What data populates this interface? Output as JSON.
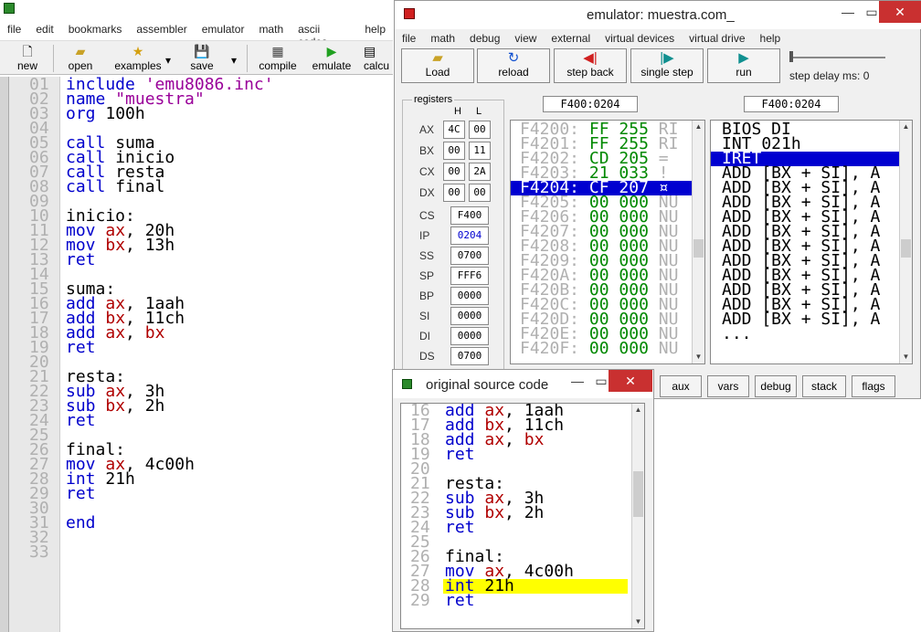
{
  "editor": {
    "menu": [
      "file",
      "edit",
      "bookmarks",
      "assembler",
      "emulator",
      "math",
      "ascii codes",
      "help"
    ],
    "toolbar": [
      {
        "label": "new",
        "icon": "new-file-icon"
      },
      {
        "label": "open",
        "icon": "open-folder-icon"
      },
      {
        "label": "examples",
        "icon": "star-icon"
      },
      {
        "label": "save",
        "icon": "floppy-icon"
      },
      {
        "label": "compile",
        "icon": "compile-icon"
      },
      {
        "label": "emulate",
        "icon": "play-icon"
      },
      {
        "label": "calcu",
        "icon": "calculator-icon"
      }
    ],
    "line_numbers": [
      "01",
      "02",
      "03",
      "04",
      "05",
      "06",
      "07",
      "08",
      "09",
      "10",
      "11",
      "12",
      "13",
      "14",
      "15",
      "16",
      "17",
      "18",
      "19",
      "20",
      "21",
      "22",
      "23",
      "24",
      "25",
      "26",
      "27",
      "28",
      "29",
      "30",
      "31",
      "32",
      "33"
    ],
    "lines": [
      [
        [
          "kw",
          "include "
        ],
        [
          "str",
          "'emu8086.inc'"
        ]
      ],
      [
        [
          "kw",
          "name "
        ],
        [
          "str",
          "\"muestra\""
        ]
      ],
      [
        [
          "kw",
          "org "
        ],
        [
          "txt",
          "100h"
        ]
      ],
      [],
      [
        [
          "kw",
          "call "
        ],
        [
          "txt",
          "suma"
        ]
      ],
      [
        [
          "kw",
          "call "
        ],
        [
          "txt",
          "inicio"
        ]
      ],
      [
        [
          "kw",
          "call "
        ],
        [
          "txt",
          "resta"
        ]
      ],
      [
        [
          "kw",
          "call "
        ],
        [
          "txt",
          "final"
        ]
      ],
      [],
      [
        [
          "txt",
          "inicio:"
        ]
      ],
      [
        [
          "kw",
          "mov "
        ],
        [
          "reg",
          "ax"
        ],
        [
          "txt",
          ", 20h"
        ]
      ],
      [
        [
          "kw",
          "mov "
        ],
        [
          "reg",
          "bx"
        ],
        [
          "txt",
          ", 13h"
        ]
      ],
      [
        [
          "kw",
          "ret"
        ]
      ],
      [],
      [
        [
          "txt",
          "suma:"
        ]
      ],
      [
        [
          "kw",
          "add "
        ],
        [
          "reg",
          "ax"
        ],
        [
          "txt",
          ", 1aah"
        ]
      ],
      [
        [
          "kw",
          "add "
        ],
        [
          "reg",
          "bx"
        ],
        [
          "txt",
          ", 11ch"
        ]
      ],
      [
        [
          "kw",
          "add "
        ],
        [
          "reg",
          "ax"
        ],
        [
          "txt",
          ", "
        ],
        [
          "reg",
          "bx"
        ]
      ],
      [
        [
          "kw",
          "ret"
        ]
      ],
      [],
      [
        [
          "txt",
          "resta:"
        ]
      ],
      [
        [
          "kw",
          "sub "
        ],
        [
          "reg",
          "ax"
        ],
        [
          "txt",
          ", 3h"
        ]
      ],
      [
        [
          "kw",
          "sub "
        ],
        [
          "reg",
          "bx"
        ],
        [
          "txt",
          ", 2h"
        ]
      ],
      [
        [
          "kw",
          "ret"
        ]
      ],
      [],
      [
        [
          "txt",
          "final:"
        ]
      ],
      [
        [
          "kw",
          "mov "
        ],
        [
          "reg",
          "ax"
        ],
        [
          "txt",
          ", 4c00h"
        ]
      ],
      [
        [
          "kw",
          "int "
        ],
        [
          "txt",
          "21h"
        ]
      ],
      [
        [
          "kw",
          "ret"
        ]
      ],
      [],
      [
        [
          "kw",
          "end"
        ]
      ],
      [],
      []
    ]
  },
  "emulator": {
    "title": "emulator: muestra.com_",
    "menu": [
      "file",
      "math",
      "debug",
      "view",
      "external",
      "virtual devices",
      "virtual drive",
      "help"
    ],
    "buttons": [
      {
        "label": "Load",
        "icon": "load-icon"
      },
      {
        "label": "reload",
        "icon": "reload-icon"
      },
      {
        "label": "step back",
        "icon": "step-back-icon"
      },
      {
        "label": "single step",
        "icon": "single-step-icon"
      },
      {
        "label": "run",
        "icon": "run-icon"
      }
    ],
    "step_delay_label": "step delay ms: 0",
    "addr_left": "F400:0204",
    "addr_right": "F400:0204",
    "registers_title": "registers",
    "hl_header": {
      "h": "H",
      "l": "L"
    },
    "hl_regs": [
      {
        "name": "AX",
        "h": "4C",
        "l": "00"
      },
      {
        "name": "BX",
        "h": "00",
        "l": "11"
      },
      {
        "name": "CX",
        "h": "00",
        "l": "2A"
      },
      {
        "name": "DX",
        "h": "00",
        "l": "00"
      }
    ],
    "seg_regs": [
      {
        "name": "CS",
        "value": "F400"
      },
      {
        "name": "IP",
        "value": "0204"
      },
      {
        "name": "SS",
        "value": "0700"
      },
      {
        "name": "SP",
        "value": "FFF6"
      },
      {
        "name": "BP",
        "value": "0000"
      },
      {
        "name": "SI",
        "value": "0000"
      },
      {
        "name": "DI",
        "value": "0000"
      },
      {
        "name": "DS",
        "value": "0700"
      }
    ],
    "memory": [
      {
        "addr": "F4200:",
        "hex": "FF",
        "dec": "255",
        "ch": "RI"
      },
      {
        "addr": "F4201:",
        "hex": "FF",
        "dec": "255",
        "ch": "RI"
      },
      {
        "addr": "F4202:",
        "hex": "CD",
        "dec": "205",
        "ch": "="
      },
      {
        "addr": "F4203:",
        "hex": "21",
        "dec": "033",
        "ch": "!"
      },
      {
        "addr": "F4204:",
        "hex": "CF",
        "dec": "207",
        "ch": "¤"
      },
      {
        "addr": "F4205:",
        "hex": "00",
        "dec": "000",
        "ch": "NU"
      },
      {
        "addr": "F4206:",
        "hex": "00",
        "dec": "000",
        "ch": "NU"
      },
      {
        "addr": "F4207:",
        "hex": "00",
        "dec": "000",
        "ch": "NU"
      },
      {
        "addr": "F4208:",
        "hex": "00",
        "dec": "000",
        "ch": "NU"
      },
      {
        "addr": "F4209:",
        "hex": "00",
        "dec": "000",
        "ch": "NU"
      },
      {
        "addr": "F420A:",
        "hex": "00",
        "dec": "000",
        "ch": "NU"
      },
      {
        "addr": "F420B:",
        "hex": "00",
        "dec": "000",
        "ch": "NU"
      },
      {
        "addr": "F420C:",
        "hex": "00",
        "dec": "000",
        "ch": "NU"
      },
      {
        "addr": "F420D:",
        "hex": "00",
        "dec": "000",
        "ch": "NU"
      },
      {
        "addr": "F420E:",
        "hex": "00",
        "dec": "000",
        "ch": "NU"
      },
      {
        "addr": "F420F:",
        "hex": "00",
        "dec": "000",
        "ch": "NU"
      }
    ],
    "disasm": [
      "BIOS DI",
      "INT 021h",
      "IRET",
      "ADD [BX + SI], A",
      "ADD [BX + SI], A",
      "ADD [BX + SI], A",
      "ADD [BX + SI], A",
      "ADD [BX + SI], A",
      "ADD [BX + SI], A",
      "ADD [BX + SI], A",
      "ADD [BX + SI], A",
      "ADD [BX + SI], A",
      "ADD [BX + SI], A",
      "ADD [BX + SI], A",
      "..."
    ],
    "bottom_buttons": [
      "aux",
      "vars",
      "debug",
      "stack",
      "flags"
    ]
  },
  "source": {
    "title": "original source code",
    "numbers": [
      "16",
      "17",
      "18",
      "19",
      "20",
      "21",
      "22",
      "23",
      "24",
      "25",
      "26",
      "27",
      "28",
      "29"
    ],
    "lines": [
      [
        [
          "kw",
          "add "
        ],
        [
          "reg",
          "ax"
        ],
        [
          "txt",
          ", 1aah"
        ]
      ],
      [
        [
          "kw",
          "add "
        ],
        [
          "reg",
          "bx"
        ],
        [
          "txt",
          ", 11ch"
        ]
      ],
      [
        [
          "kw",
          "add "
        ],
        [
          "reg",
          "ax"
        ],
        [
          "txt",
          ", "
        ],
        [
          "reg",
          "bx"
        ]
      ],
      [
        [
          "kw",
          "ret"
        ]
      ],
      [],
      [
        [
          "txt",
          "resta:"
        ]
      ],
      [
        [
          "kw",
          "sub "
        ],
        [
          "reg",
          "ax"
        ],
        [
          "txt",
          ", 3h"
        ]
      ],
      [
        [
          "kw",
          "sub "
        ],
        [
          "reg",
          "bx"
        ],
        [
          "txt",
          ", 2h"
        ]
      ],
      [
        [
          "kw",
          "ret"
        ]
      ],
      [],
      [
        [
          "txt",
          "final:"
        ]
      ],
      [
        [
          "kw",
          "mov "
        ],
        [
          "reg",
          "ax"
        ],
        [
          "txt",
          ", 4c00h"
        ]
      ],
      [
        [
          "kw",
          "int "
        ],
        [
          "txt",
          "21h"
        ]
      ],
      [
        [
          "kw",
          "ret"
        ]
      ]
    ]
  }
}
